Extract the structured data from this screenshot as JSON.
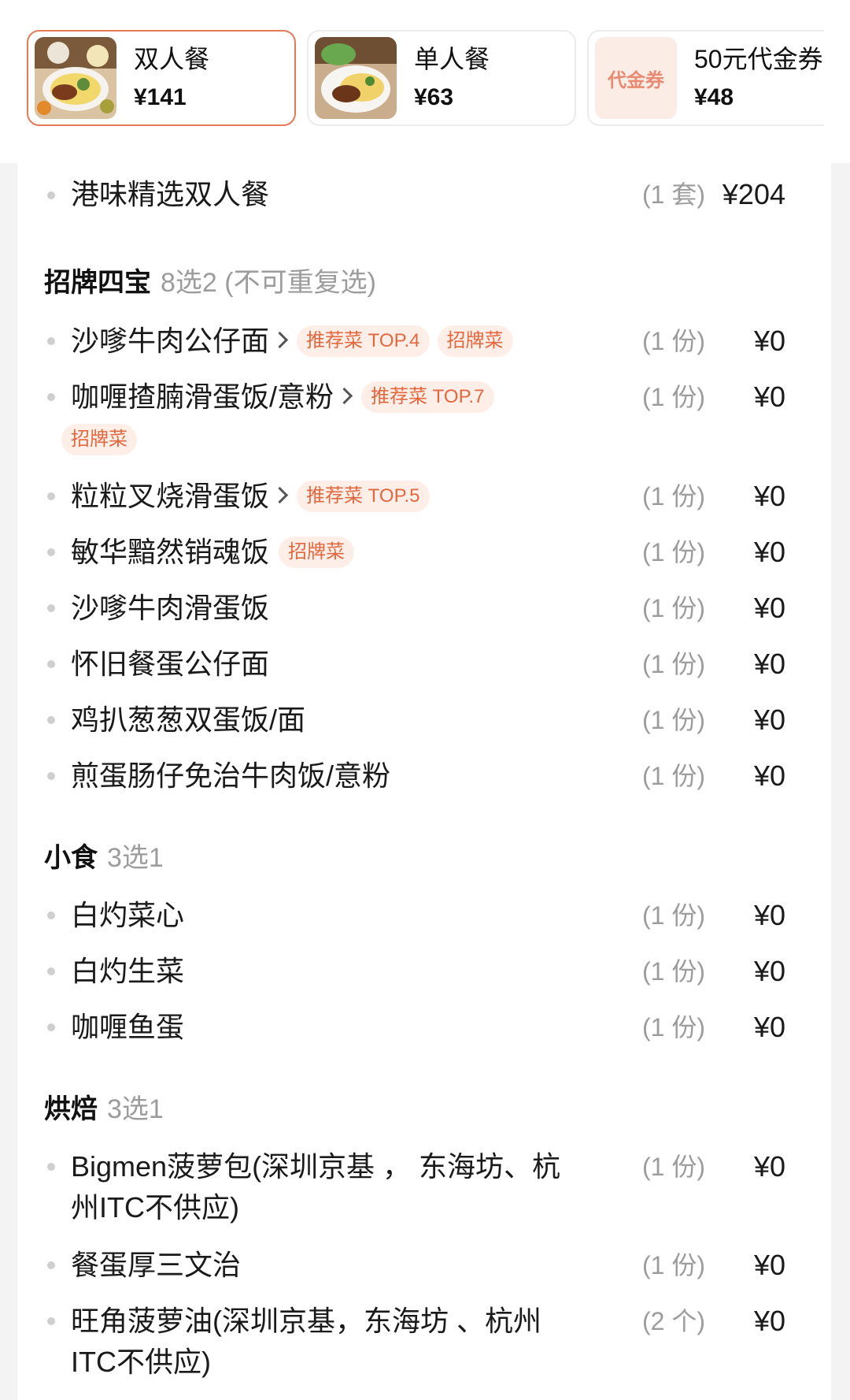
{
  "meal_cards": [
    {
      "name": "双人餐",
      "price": "¥141",
      "active": true,
      "thumb_icon": "food-photo-icon"
    },
    {
      "name": "单人餐",
      "price": "¥63",
      "active": false,
      "thumb_icon": "food-photo-icon"
    },
    {
      "name": "50元代金券",
      "price": "¥48",
      "active": false,
      "thumb_label": "代金券"
    }
  ],
  "package": {
    "name": "港味精选双人餐",
    "qty": "(1 套)",
    "price": "¥204"
  },
  "sections": [
    {
      "title": "招牌四宝",
      "rule": "8选2 (不可重复选)",
      "items": [
        {
          "name": "沙嗲牛肉公仔面",
          "tags": [
            "推荐菜 TOP.4",
            "招牌菜"
          ],
          "has_link": true,
          "qty": "(1 份)",
          "price": "¥0"
        },
        {
          "name": "咖喱揸腩滑蛋饭/意粉",
          "tags": [
            "推荐菜 TOP.7",
            "招牌菜"
          ],
          "has_link": true,
          "qty": "(1 份)",
          "price": "¥0"
        },
        {
          "name": "粒粒叉烧滑蛋饭",
          "tags": [
            "推荐菜 TOP.5"
          ],
          "has_link": true,
          "qty": "(1 份)",
          "price": "¥0"
        },
        {
          "name": "敏华黯然销魂饭",
          "tags": [
            "招牌菜"
          ],
          "has_link": false,
          "qty": "(1 份)",
          "price": "¥0"
        },
        {
          "name": "沙嗲牛肉滑蛋饭",
          "tags": [],
          "has_link": false,
          "qty": "(1 份)",
          "price": "¥0"
        },
        {
          "name": "怀旧餐蛋公仔面",
          "tags": [],
          "has_link": false,
          "qty": "(1 份)",
          "price": "¥0"
        },
        {
          "name": "鸡扒葱葱双蛋饭/面",
          "tags": [],
          "has_link": false,
          "qty": "(1 份)",
          "price": "¥0"
        },
        {
          "name": "煎蛋肠仔免治牛肉饭/意粉",
          "tags": [],
          "has_link": false,
          "qty": "(1 份)",
          "price": "¥0"
        }
      ]
    },
    {
      "title": "小食",
      "rule": "3选1",
      "items": [
        {
          "name": "白灼菜心",
          "qty": "(1 份)",
          "price": "¥0"
        },
        {
          "name": "白灼生菜",
          "qty": "(1 份)",
          "price": "¥0"
        },
        {
          "name": "咖喱鱼蛋",
          "qty": "(1 份)",
          "price": "¥0"
        }
      ]
    },
    {
      "title": "烘焙",
      "rule": "3选1",
      "items": [
        {
          "name": "Bigmen菠萝包(深圳京基 ， 东海坊、杭州ITC不供应)",
          "qty": "(1 份)",
          "price": "¥0"
        },
        {
          "name": "餐蛋厚三文治",
          "qty": "(1 份)",
          "price": "¥0"
        },
        {
          "name": "旺角菠萝油(深圳京基，东海坊 、杭州ITC不供应)",
          "qty": "(2 个)",
          "price": "¥0"
        }
      ]
    }
  ],
  "colors": {
    "accent": "#e57a57",
    "tag_bg": "#fdeee8",
    "tag_text": "#e2683f",
    "muted": "#9c9c9c"
  }
}
